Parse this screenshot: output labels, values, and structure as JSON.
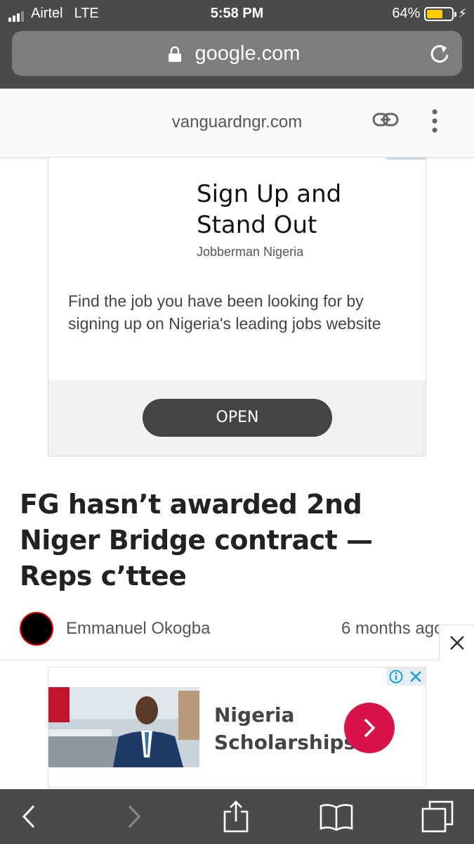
{
  "status_bar": {
    "carrier": "Airtel",
    "network": "LTE",
    "time": "5:58 PM",
    "battery_percent": "64%",
    "battery_level": 0.64
  },
  "browser": {
    "url": "google.com",
    "lock_icon": "lock-icon",
    "reload_icon": "reload-icon"
  },
  "amp_header": {
    "domain": "vanguardngr.com",
    "link_icon": "link-icon",
    "more_icon": "more-vertical-icon"
  },
  "ad1": {
    "title": "Sign Up and Stand Out",
    "sponsor": "Jobberman Nigeria",
    "description": "Find the job you have been looking for by signing up on Nigeria's leading jobs website",
    "cta": "OPEN"
  },
  "article": {
    "headline": "FG hasn’t awarded 2nd Niger Bridge contract — Reps c’ttee",
    "author": "Emmanuel Okogba",
    "posted": "6 months ago"
  },
  "ad2": {
    "text": "Nigeria Scholarships",
    "cta_color": "#d8134a"
  },
  "toolbar": {
    "icons": [
      "back-icon",
      "forward-icon",
      "share-icon",
      "bookmarks-icon",
      "tabs-icon"
    ]
  },
  "colors": {
    "chrome": "#4a4a4a",
    "battery": "#ffcc00",
    "ad_cta": "#444444"
  }
}
